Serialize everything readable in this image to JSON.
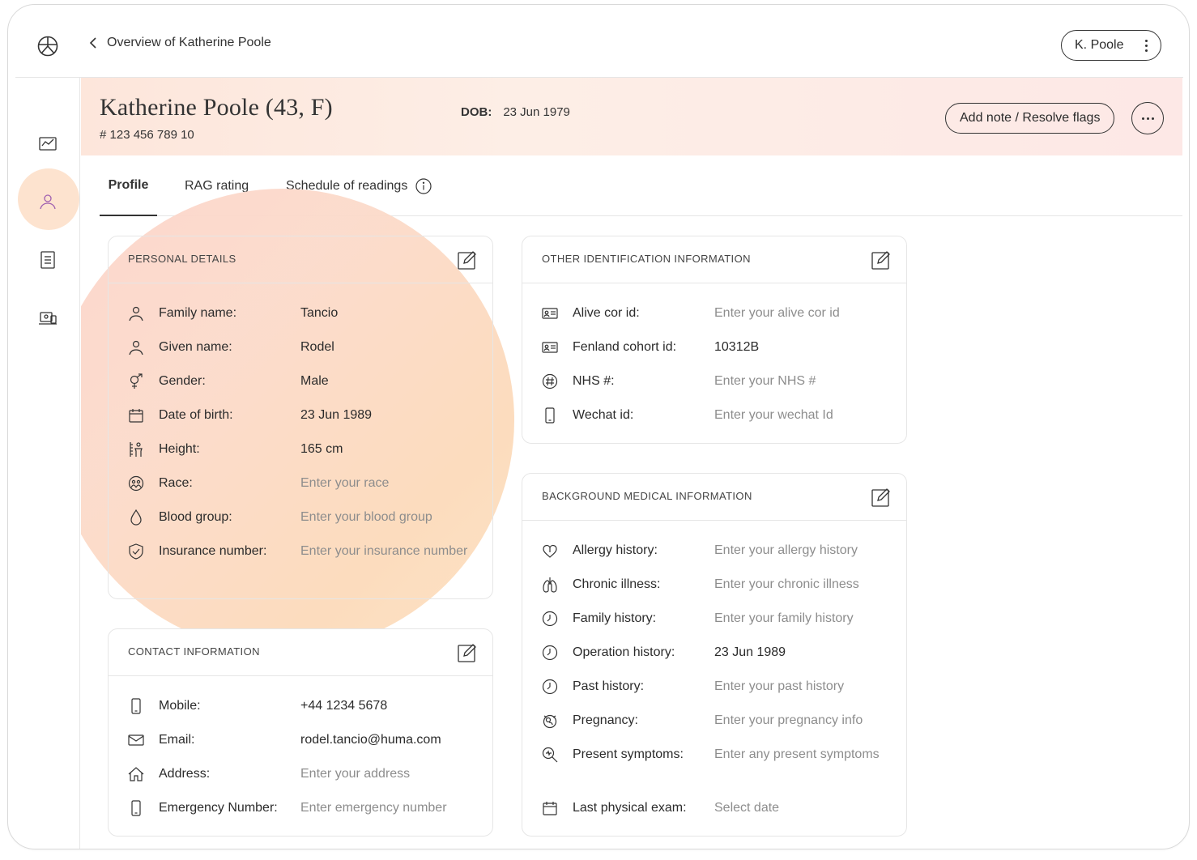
{
  "topbar": {
    "back_label": "Overview of Katherine Poole",
    "user_label": "K. Poole"
  },
  "patient": {
    "name": "Katherine Poole (43, F)",
    "id": "# 123 456 789 10",
    "dob_label": "DOB:",
    "dob_value": "23 Jun 1979",
    "action_label": "Add note / Resolve flags"
  },
  "tabs": [
    {
      "label": "Profile"
    },
    {
      "label": "RAG rating"
    },
    {
      "label": "Schedule of readings"
    }
  ],
  "personal": {
    "title": "PERSONAL DETAILS",
    "rows": [
      {
        "label": "Family name:",
        "value": "Tancio",
        "placeholder": ""
      },
      {
        "label": "Given name:",
        "value": "Rodel",
        "placeholder": ""
      },
      {
        "label": "Gender:",
        "value": "Male",
        "placeholder": ""
      },
      {
        "label": "Date of birth:",
        "value": "23 Jun 1989",
        "placeholder": ""
      },
      {
        "label": "Height:",
        "value": "165 cm",
        "placeholder": ""
      },
      {
        "label": "Race:",
        "value": "",
        "placeholder": "Enter your race"
      },
      {
        "label": "Blood group:",
        "value": "",
        "placeholder": "Enter your blood group"
      },
      {
        "label": "Insurance number:",
        "value": "",
        "placeholder": "Enter your insurance number"
      }
    ]
  },
  "contact": {
    "title": "CONTACT INFORMATION",
    "rows": [
      {
        "label": "Mobile:",
        "value": "+44 1234 5678",
        "placeholder": ""
      },
      {
        "label": "Email:",
        "value": "rodel.tancio@huma.com",
        "placeholder": ""
      },
      {
        "label": "Address:",
        "value": "",
        "placeholder": "Enter your address"
      },
      {
        "label": "Emergency Number:",
        "value": "",
        "placeholder": "Enter emergency number"
      }
    ]
  },
  "other_id": {
    "title": "OTHER IDENTIFICATION INFORMATION",
    "rows": [
      {
        "label": "Alive cor id:",
        "value": "",
        "placeholder": "Enter your alive cor id"
      },
      {
        "label": "Fenland cohort id:",
        "value": "10312B",
        "placeholder": ""
      },
      {
        "label": "NHS #:",
        "value": "",
        "placeholder": "Enter your NHS #"
      },
      {
        "label": "Wechat id:",
        "value": "",
        "placeholder": "Enter your wechat Id"
      }
    ]
  },
  "medical": {
    "title": "BACKGROUND MEDICAL INFORMATION",
    "rows": [
      {
        "label": "Allergy history:",
        "value": "",
        "placeholder": "Enter your allergy history"
      },
      {
        "label": "Chronic illness:",
        "value": "",
        "placeholder": "Enter your chronic illness"
      },
      {
        "label": "Family history:",
        "value": "",
        "placeholder": "Enter your family history"
      },
      {
        "label": "Operation history:",
        "value": "23 Jun 1989",
        "placeholder": ""
      },
      {
        "label": "Past history:",
        "value": "",
        "placeholder": "Enter your past history"
      },
      {
        "label": "Pregnancy:",
        "value": "",
        "placeholder": "Enter your pregnancy info"
      },
      {
        "label": "Present symptoms:",
        "value": "",
        "placeholder": "Enter any present symptoms"
      },
      {
        "label": "Last physical exam:",
        "value": "",
        "placeholder": "Select date"
      }
    ]
  }
}
